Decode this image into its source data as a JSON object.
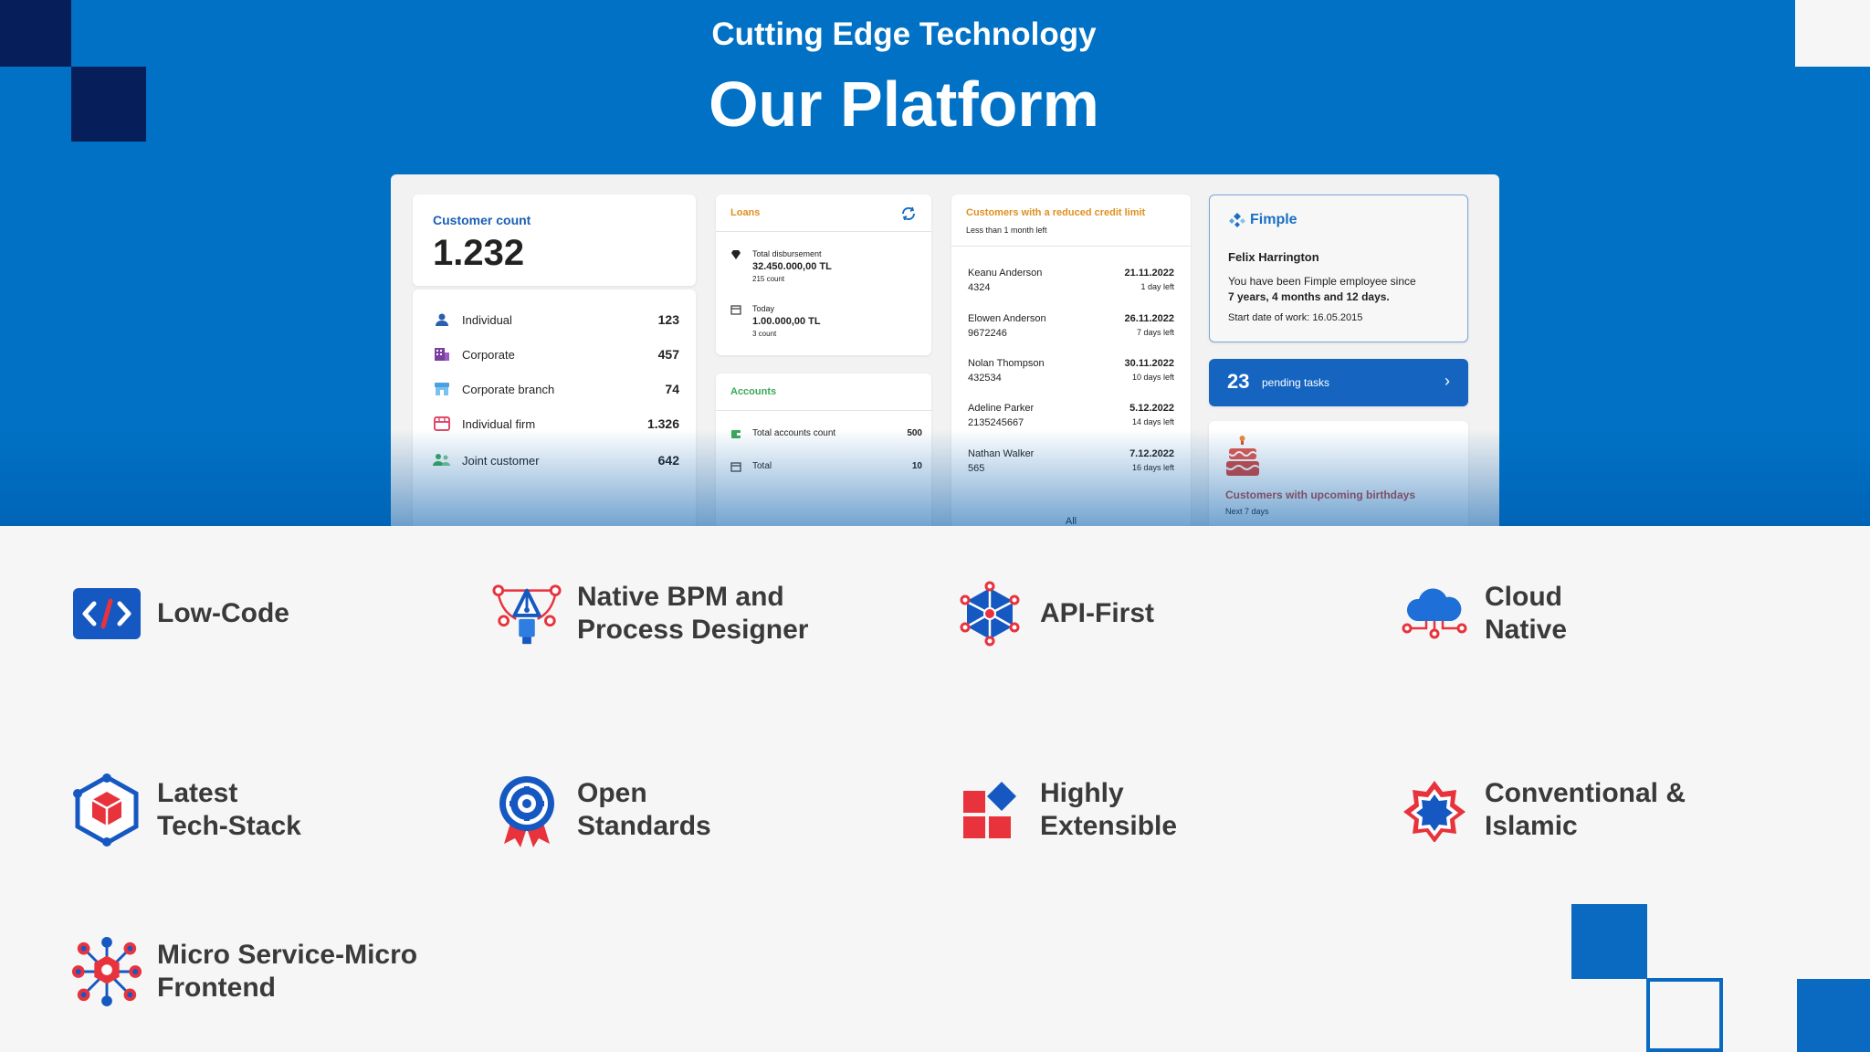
{
  "header": {
    "subtitle": "Cutting Edge Technology",
    "title": "Our Platform"
  },
  "dashboard": {
    "customer_count": {
      "label": "Customer count",
      "value": "1.232",
      "rows": [
        {
          "label": "Individual",
          "value": "123",
          "icon": "person-icon"
        },
        {
          "label": "Corporate",
          "value": "457",
          "icon": "building-icon"
        },
        {
          "label": "Corporate branch",
          "value": "74",
          "icon": "store-icon"
        },
        {
          "label": "Individual firm",
          "value": "1.326",
          "icon": "shop-icon"
        },
        {
          "label": "Joint customer",
          "value": "642",
          "icon": "people-icon"
        }
      ]
    },
    "loans": {
      "label": "Loans",
      "total_disbursement_label": "Total disbursement",
      "total_disbursement_value": "32.450.000,00 TL",
      "total_disbursement_count": "215 count",
      "today_label": "Today",
      "today_value": "1.00.000,00 TL",
      "today_count": "3 count"
    },
    "accounts": {
      "label": "Accounts",
      "rows": [
        {
          "label": "Total accounts count",
          "value": "500"
        },
        {
          "label": "Total",
          "value": "10"
        }
      ]
    },
    "reduced_limit": {
      "label": "Customers with a reduced credit limit",
      "sublabel": "Less than 1 month left",
      "customers": [
        {
          "name": "Keanu Anderson",
          "id": "4324",
          "date": "21.11.2022",
          "left": "1 day left"
        },
        {
          "name": "Elowen Anderson",
          "id": "9672246",
          "date": "26.11.2022",
          "left": "7 days left"
        },
        {
          "name": "Nolan Thompson",
          "id": "432534",
          "date": "30.11.2022",
          "left": "10 days left"
        },
        {
          "name": "Adeline Parker",
          "id": "2135245667",
          "date": "5.12.2022",
          "left": "14 days left"
        },
        {
          "name": "Nathan Walker",
          "id": "565",
          "date": "7.12.2022",
          "left": "16 days left"
        }
      ],
      "all_label": "All"
    },
    "employee": {
      "brand": "Fimple",
      "name": "Felix Harrington",
      "since_text": "You have been Fimple employee since",
      "duration": "7 years, 4 months and 12 days.",
      "start_date": "Start date of work: 16.05.2015"
    },
    "pending": {
      "count": "23",
      "label": "pending tasks"
    },
    "birthdays": {
      "label": "Customers with upcoming birthdays",
      "sublabel": "Next 7 days"
    }
  },
  "features": [
    {
      "label": "Low-Code",
      "icon": "code-icon"
    },
    {
      "label": "Native BPM and Process Designer",
      "icon": "pen-tool-icon"
    },
    {
      "label": "API-First",
      "icon": "network-icon"
    },
    {
      "label": "Cloud Native",
      "icon": "cloud-icon"
    },
    {
      "label": "Latest Tech-Stack",
      "icon": "cube-icon"
    },
    {
      "label": "Open Standards",
      "icon": "badge-icon"
    },
    {
      "label": "Highly Extensible",
      "icon": "blocks-icon"
    },
    {
      "label": "Conventional & Islamic",
      "icon": "star-icon"
    },
    {
      "label": "Micro Service-Micro Frontend",
      "icon": "microservice-icon"
    }
  ],
  "colors": {
    "primary": "#0071c5",
    "dark_navy": "#061f5b",
    "accent_red": "#e8323c",
    "text_dark": "#3a3a3a"
  }
}
